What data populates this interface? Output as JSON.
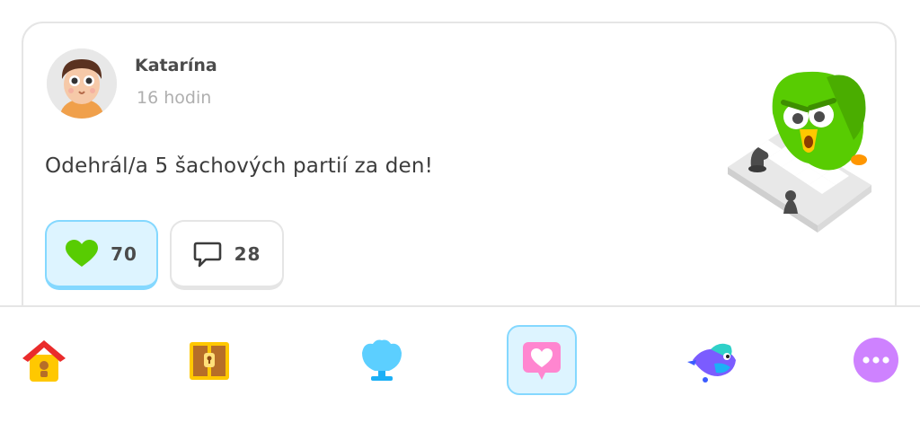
{
  "post": {
    "user_name": "Katarína",
    "time": "16 hodin",
    "text": "Odehrál/a 5 šachových partií za den!",
    "likes": "70",
    "comments": "28"
  },
  "icons": {
    "like": "heart-icon",
    "comment": "speech-bubble-icon"
  },
  "tabs": [
    {
      "name": "home",
      "icon": "birdhouse-icon",
      "active": false
    },
    {
      "name": "treasure",
      "icon": "treasure-chest-icon",
      "active": false
    },
    {
      "name": "league",
      "icon": "shell-trophy-icon",
      "active": false
    },
    {
      "name": "feed",
      "icon": "heart-bubble-icon",
      "active": true
    },
    {
      "name": "learning",
      "icon": "bird-icon",
      "active": false
    },
    {
      "name": "more",
      "icon": "more-dots-icon",
      "active": false
    }
  ],
  "colors": {
    "like_green": "#58cc02",
    "active_blue": "#84d8ff",
    "active_bg": "#ddf4ff",
    "more_purple": "#ce82ff",
    "feed_pink": "#ff86d0"
  }
}
